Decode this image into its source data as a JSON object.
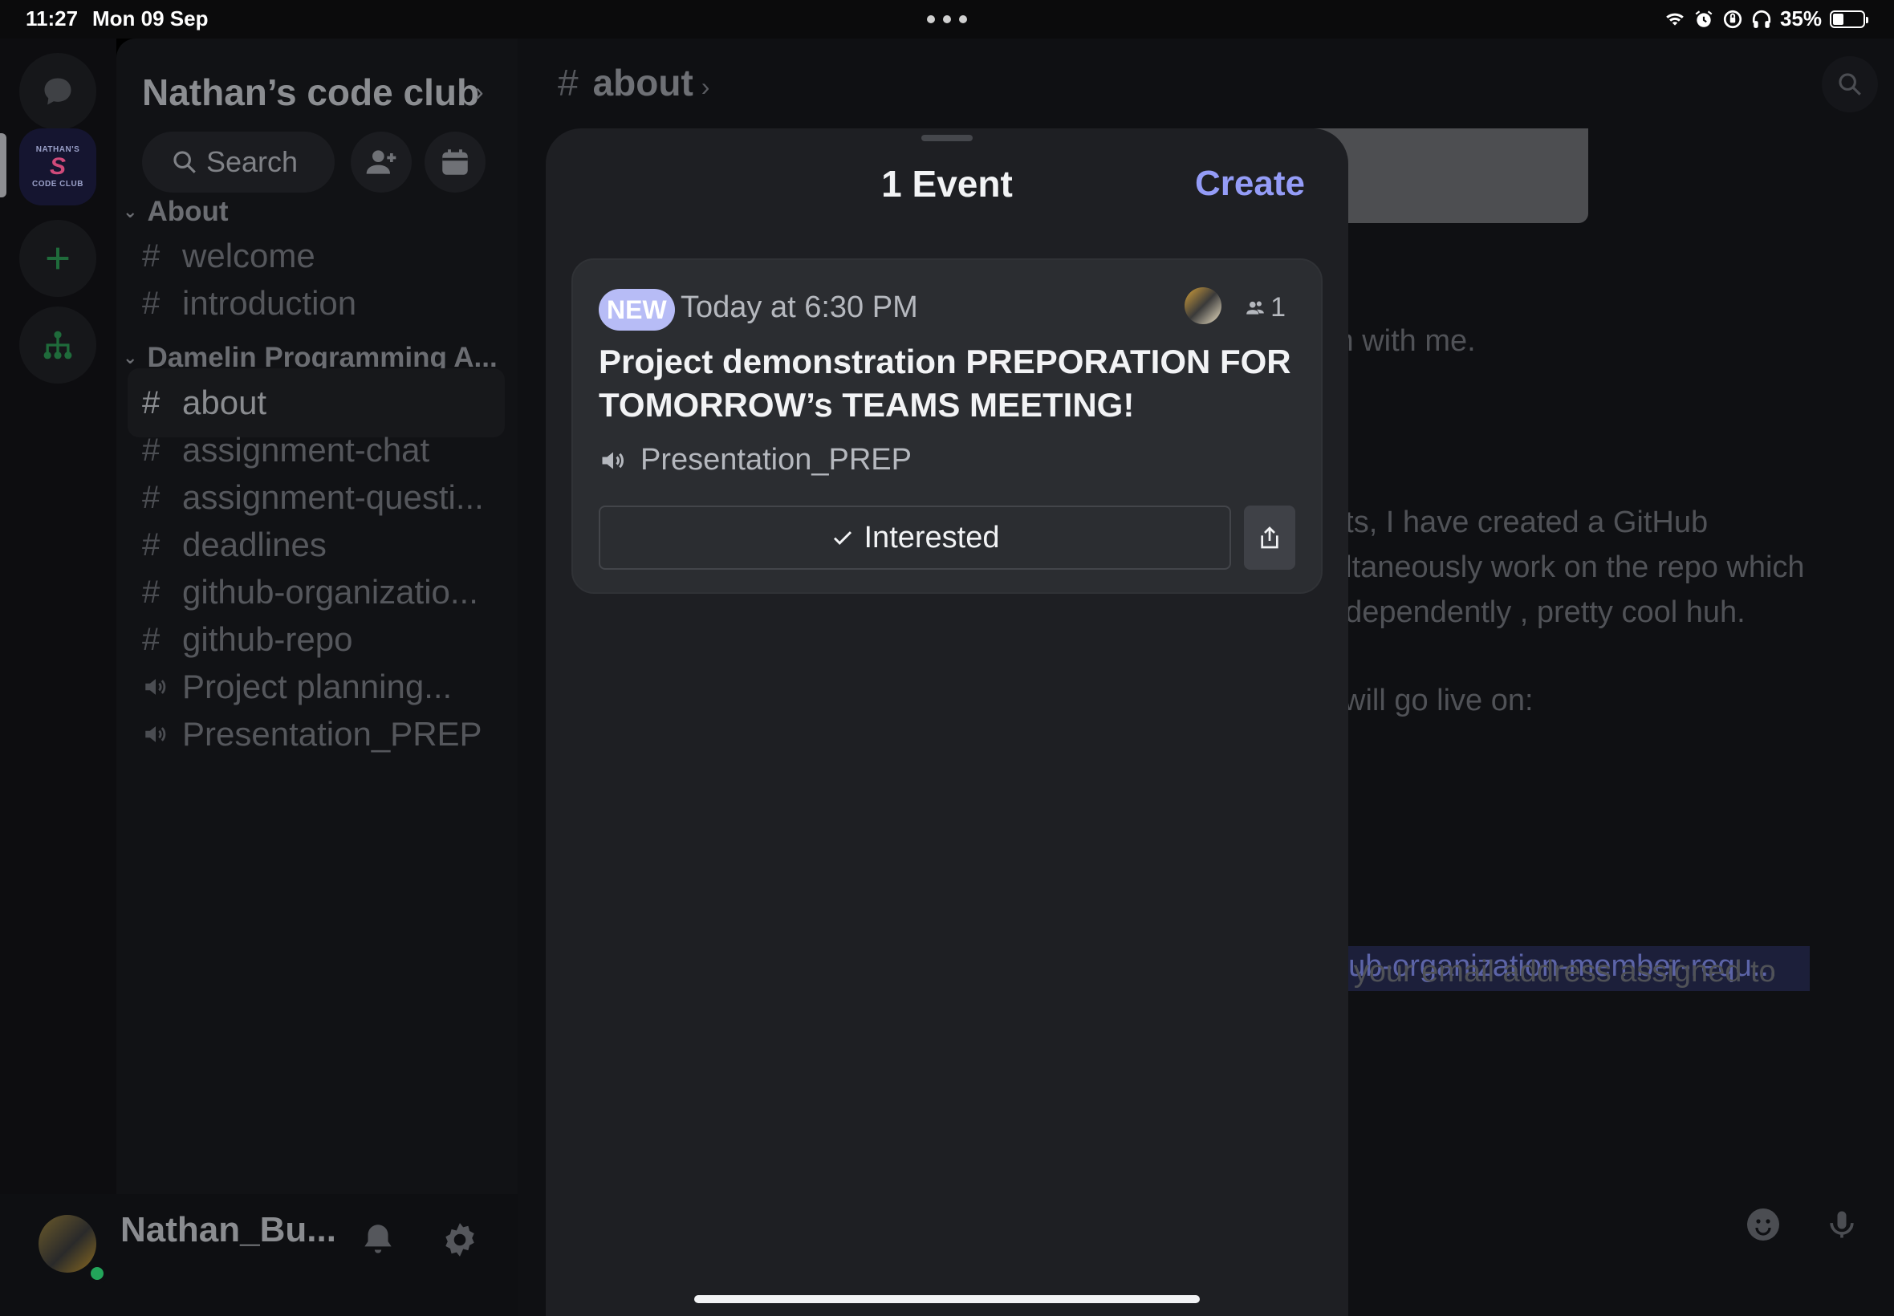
{
  "status_bar": {
    "time": "11:27",
    "date": "Mon 09 Sep",
    "battery_percent": "35%",
    "battery_level": 0.35
  },
  "rail": {
    "logo_text": "NATHAN'S",
    "logo_subtext": "CODE CLUB"
  },
  "server": {
    "name": "Nathan’s code club",
    "search_placeholder": "Search"
  },
  "categories": [
    {
      "label": "About",
      "channels": [
        "welcome",
        "introduction"
      ]
    },
    {
      "label": "Damelin Programming A...",
      "channels": [
        "about",
        "assignment-chat",
        "assignment-questi...",
        "deadlines",
        "github-organizatio...",
        "github-repo",
        "Project planning...",
        "Presentation_PREP"
      ]
    }
  ],
  "channels": {
    "welcome": "welcome",
    "introduction": "introduction",
    "about": "about",
    "assignment_chat": "assignment-chat",
    "assignment_questions": "assignment-questi...",
    "deadlines": "deadlines",
    "github_organization": "github-organizatio...",
    "github_repo": "github-repo",
    "project_planning": "Project planning...",
    "presentation_prep": "Presentation_PREP"
  },
  "user": {
    "name": "Nathan_Bu..."
  },
  "chat": {
    "channel_title": "about",
    "messages": [
      "m with me.",
      "nts, I have created a GitHub",
      "ultaneously work on the repo which",
      "ndependently , pretty cool huh.",
      "l will go live on:",
      "hub-organization-member-requ...",
      "o your email address assigned to"
    ]
  },
  "events_sheet": {
    "title": "1 Event",
    "create_label": "Create",
    "event": {
      "badge": "NEW",
      "time": "Today at 6:30 PM",
      "interested_count": "1",
      "name": "Project demonstration PREPORATION FOR TOMORROW’s TEAMS MEETING!",
      "location": "Presentation_PREP",
      "interested_label": "Interested"
    }
  },
  "colors": {
    "accent": "#949cf7",
    "badge": "#b7bcf6",
    "sheet_bg": "#1e1f23",
    "card_bg": "#2b2d31",
    "online": "#23a55a"
  }
}
